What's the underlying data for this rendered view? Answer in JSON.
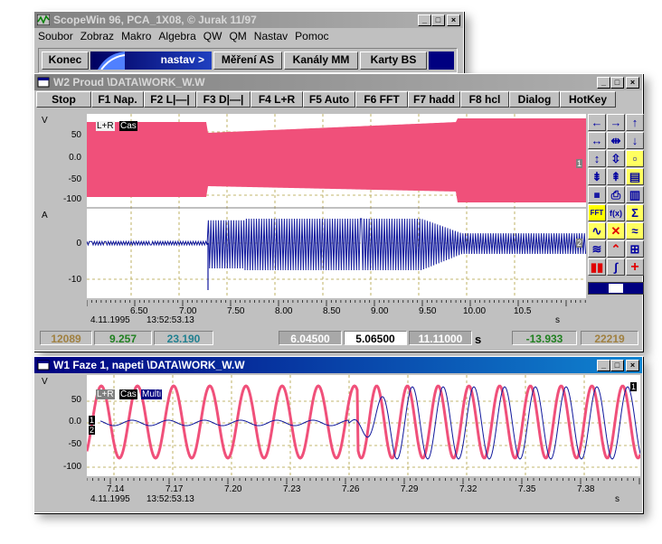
{
  "main_window": {
    "title": "ScopeWin 96, PCA_1X08, © Jurak 11/97",
    "menu": [
      "Soubor",
      "Zobraz",
      "Makro",
      "Algebra",
      "QW",
      "QM",
      "Nastav",
      "Pomoc"
    ],
    "toolbar": {
      "konec": "Konec",
      "nastav": "nastav >",
      "mereni": "Měření AS",
      "kanaly": "Kanály MM",
      "karty": "Karty BS"
    }
  },
  "w2": {
    "title": "W2 Proud \\DATA\\WORK_W.W",
    "buttons": [
      "Stop",
      "F1 Nap.",
      "F2 L|—|",
      "F3 D|—|",
      "F4 L+R",
      "F5 Auto",
      "F6 FFT",
      "F7 hadd",
      "F8 hcl",
      "Dialog",
      "HotKey"
    ],
    "legend": {
      "lr": "L+R",
      "cas": "Čas"
    },
    "ch1_unit": "V",
    "ch1_ticks": [
      "50",
      "0.0",
      "-50",
      "-100"
    ],
    "ch2_unit": "A",
    "ch2_ticks": [
      "0",
      "-10"
    ],
    "x_ticks": [
      "6.50",
      "7.00",
      "7.50",
      "8.00",
      "8.50",
      "9.00",
      "9.50",
      "10.00",
      "10.5"
    ],
    "x_unit": "s",
    "date": "4.11.1995",
    "time": "13:52:53.13",
    "markers": [
      "1",
      "2"
    ],
    "readouts": {
      "left1": "12089",
      "left2": "9.257",
      "left3": "23.190",
      "mid1": "6.04500",
      "mid2": "5.06500",
      "mid3": "11.11000",
      "unit": "s",
      "right1": "-13.933",
      "right2": "22219"
    }
  },
  "w1": {
    "title": "W1 Faze 1, napeti \\DATA\\WORK_W.W",
    "legend": {
      "lr": "L+R",
      "cas": "Čas",
      "multi": "Multi"
    },
    "unit": "V",
    "y_ticks": [
      "50",
      "0.0",
      "-50",
      "-100"
    ],
    "x_ticks": [
      "7.14",
      "7.17",
      "7.20",
      "7.23",
      "7.26",
      "7.29",
      "7.32",
      "7.35",
      "7.38"
    ],
    "x_unit": "s",
    "date": "4.11.1995",
    "time": "13:52:53.13",
    "markers": [
      "1",
      "2",
      "1"
    ]
  },
  "colors": {
    "pink": "#f0507a",
    "blue": "#10189c",
    "grid": "#b0a040",
    "title": "#000080"
  }
}
